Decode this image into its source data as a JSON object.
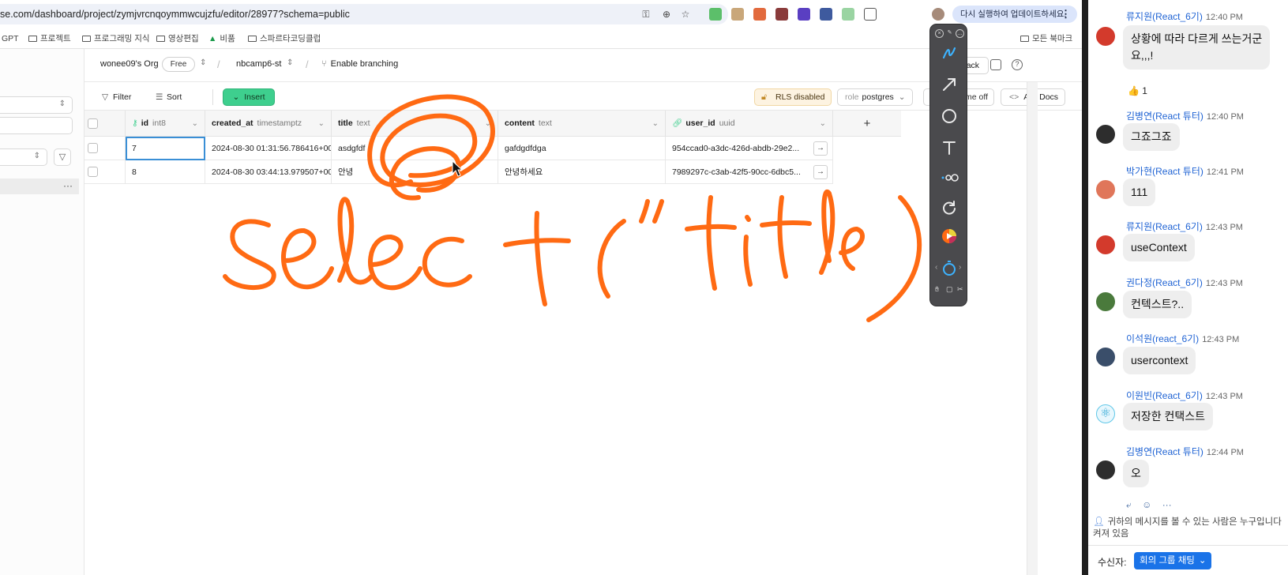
{
  "browser": {
    "url": "se.com/dashboard/project/zymjvrcnqoymmwcujzfu/editor/28977?schema=public",
    "update_chip": "다시 실행하여 업데이트하세요.",
    "bookmarks": [
      "GPT",
      "프로젝트",
      "프로그래밍 지식",
      "영상편집",
      "비품",
      "스파르타코딩클럽",
      "모든 북마크"
    ]
  },
  "header": {
    "org": "wonee09's Org",
    "plan_badge": "Free",
    "project": "nbcamp6-st",
    "branching": "Enable branching",
    "feedback": "Feedback"
  },
  "toolbar": {
    "filter": "Filter",
    "sort": "Sort",
    "insert": "Insert",
    "rls": "RLS disabled",
    "role_prefix": "role",
    "role_value": "postgres",
    "realtime": "me off",
    "api_docs": "API Docs"
  },
  "grid": {
    "columns": [
      {
        "name": "id",
        "type": "int8"
      },
      {
        "name": "created_at",
        "type": "timestamptz"
      },
      {
        "name": "title",
        "type": "text"
      },
      {
        "name": "content",
        "type": "text"
      },
      {
        "name": "user_id",
        "type": "uuid"
      }
    ],
    "rows": [
      {
        "id": "7",
        "created_at": "2024-08-30 01:31:56.786416+00",
        "title": "asdgfdf",
        "content": "gafdgdfdga",
        "user_id": "954ccad0-a3dc-426d-abdb-29e2..."
      },
      {
        "id": "8",
        "created_at": "2024-08-30 03:44:13.979507+00",
        "title": "안녕",
        "content": "안녕하세요",
        "user_id": "7989297c-c3ab-42f5-90cc-6dbc5..."
      }
    ]
  },
  "annotation": {
    "text": "select(\"title\")",
    "color": "#ff6a13"
  },
  "chat": {
    "messages": [
      {
        "sender": "류지원(React_6기)",
        "time": "12:40 PM",
        "lines": [
          "상황에 따라 다르게 쓰는거군",
          "요,,,!"
        ],
        "avatar_color": "#d33a2c"
      },
      {
        "sender": "김병연(React 튜터)",
        "time": "12:40 PM",
        "lines": [
          "그죠그죠"
        ],
        "avatar_color": "#2d2d2d"
      },
      {
        "sender": "박가현(React 튜터)",
        "time": "12:41 PM",
        "lines": [
          "111"
        ],
        "avatar_color": "#e0765a"
      },
      {
        "sender": "류지원(React_6기)",
        "time": "12:43 PM",
        "lines": [
          "useContext"
        ],
        "avatar_color": "#d33a2c"
      },
      {
        "sender": "권다정(React_6기)",
        "time": "12:43 PM",
        "lines": [
          "컨텍스트?.."
        ],
        "avatar_color": "#4a7a3c"
      },
      {
        "sender": "이석원(react_6기)",
        "time": "12:43 PM",
        "lines": [
          "usercontext"
        ],
        "avatar_color": "#3a4e6a"
      },
      {
        "sender": "이원빈(React_6기)",
        "time": "12:43 PM",
        "lines": [
          "저장한 컨택스트"
        ],
        "avatar_color": "#5fc7e8"
      },
      {
        "sender": "김병연(React 튜터)",
        "time": "12:44 PM",
        "lines": [
          "오"
        ],
        "avatar_color": "#2d2d2d"
      }
    ],
    "reaction": "👍 1",
    "visibility_note": "귀하의 메시지를 볼 수 있는 사람은 누구입니다 켜져 있음",
    "recipient_label": "수신자:",
    "recipient_value": "회의 그룹 채팅"
  },
  "colors": {
    "brand_green": "#3ecf8e",
    "chat_name_blue": "#1f63d4",
    "annotation_orange": "#ff6a13"
  }
}
